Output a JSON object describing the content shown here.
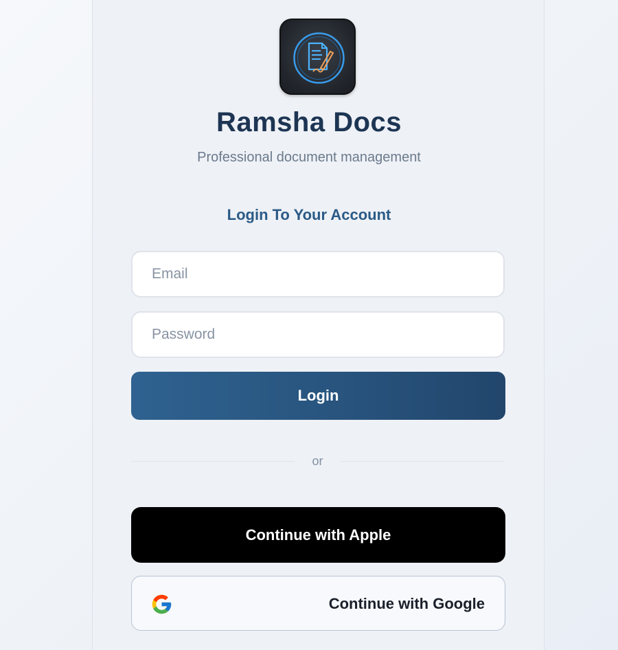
{
  "app": {
    "title": "Ramsha Docs",
    "subtitle": "Professional document management",
    "logo_icon": "document-signature-icon"
  },
  "login": {
    "heading": "Login To Your Account",
    "email_placeholder": "Email",
    "email_value": "",
    "password_placeholder": "Password",
    "password_value": "",
    "submit_label": "Login"
  },
  "divider": {
    "label": "or"
  },
  "social": {
    "apple_label": "Continue with Apple",
    "google_label": "Continue with Google",
    "google_icon": "google-icon"
  },
  "colors": {
    "primary": "#2b5a86",
    "title": "#1d3553",
    "apple_button": "#000000"
  }
}
